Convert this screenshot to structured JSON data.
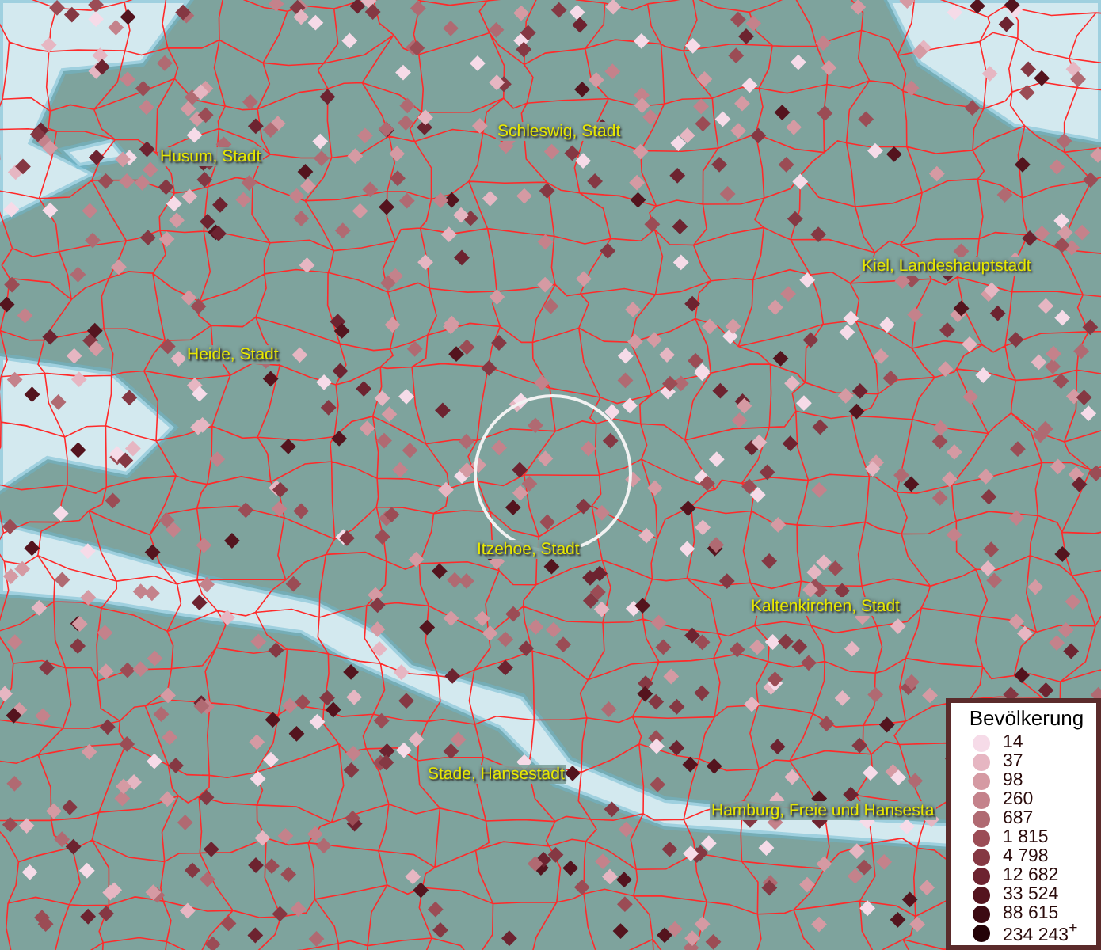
{
  "map": {
    "places": [
      {
        "name": "Husum, Stadt"
      },
      {
        "name": "Schleswig, Stadt"
      },
      {
        "name": "Kiel, Landeshauptstadt"
      },
      {
        "name": "Heide, Stadt"
      },
      {
        "name": "Itzehoe, Stadt"
      },
      {
        "name": "Kaltenkirchen, Stadt"
      },
      {
        "name": "Stade, Hansestadt"
      },
      {
        "name": "Hamburg, Freie und Hansesta"
      }
    ]
  },
  "legend": {
    "title": "Bevölkerung",
    "entries": [
      {
        "label": "14",
        "color": "#f6dbe8"
      },
      {
        "label": "37",
        "color": "#e6b6c2"
      },
      {
        "label": "98",
        "color": "#d59aa3"
      },
      {
        "label": "260",
        "color": "#c4828b"
      },
      {
        "label": "687",
        "color": "#b06a72"
      },
      {
        "label": "1 815",
        "color": "#9b4c55"
      },
      {
        "label": "4 798",
        "color": "#853843"
      },
      {
        "label": "12 682",
        "color": "#6d2330"
      },
      {
        "label": "33 524",
        "color": "#54141e"
      },
      {
        "label": "88 615",
        "color": "#3c0a12"
      },
      {
        "label": "234 243$^{+}$",
        "color": "#240307"
      }
    ]
  }
}
